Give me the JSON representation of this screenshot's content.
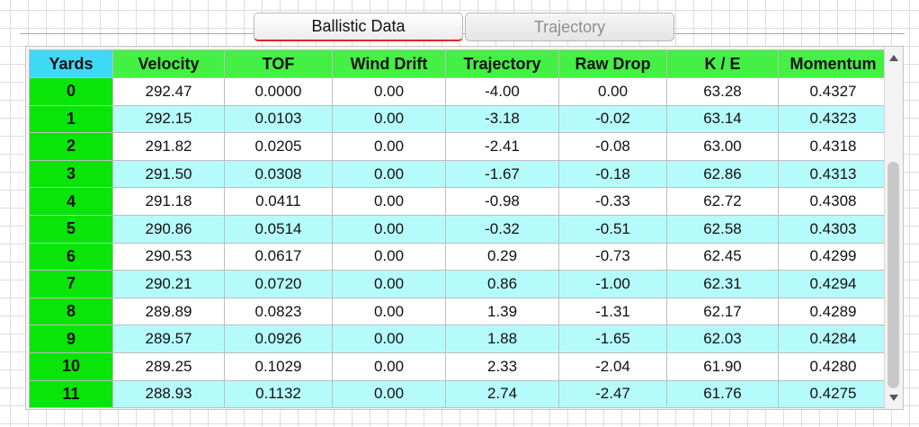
{
  "tabs": [
    {
      "label": "Ballistic Data",
      "active": true
    },
    {
      "label": "Trajectory",
      "active": false
    }
  ],
  "table": {
    "headers": [
      "Yards",
      "Velocity",
      "TOF",
      "Wind Drift",
      "Trajectory",
      "Raw Drop",
      "K / E",
      "Momentum"
    ],
    "rows": [
      [
        "0",
        "292.47",
        "0.0000",
        "0.00",
        "-4.00",
        "0.00",
        "63.28",
        "0.4327"
      ],
      [
        "1",
        "292.15",
        "0.0103",
        "0.00",
        "-3.18",
        "-0.02",
        "63.14",
        "0.4323"
      ],
      [
        "2",
        "291.82",
        "0.0205",
        "0.00",
        "-2.41",
        "-0.08",
        "63.00",
        "0.4318"
      ],
      [
        "3",
        "291.50",
        "0.0308",
        "0.00",
        "-1.67",
        "-0.18",
        "62.86",
        "0.4313"
      ],
      [
        "4",
        "291.18",
        "0.0411",
        "0.00",
        "-0.98",
        "-0.33",
        "62.72",
        "0.4308"
      ],
      [
        "5",
        "290.86",
        "0.0514",
        "0.00",
        "-0.32",
        "-0.51",
        "62.58",
        "0.4303"
      ],
      [
        "6",
        "290.53",
        "0.0617",
        "0.00",
        "0.29",
        "-0.73",
        "62.45",
        "0.4299"
      ],
      [
        "7",
        "290.21",
        "0.0720",
        "0.00",
        "0.86",
        "-1.00",
        "62.31",
        "0.4294"
      ],
      [
        "8",
        "289.89",
        "0.0823",
        "0.00",
        "1.39",
        "-1.31",
        "62.17",
        "0.4289"
      ],
      [
        "9",
        "289.57",
        "0.0926",
        "0.00",
        "1.88",
        "-1.65",
        "62.03",
        "0.4284"
      ],
      [
        "10",
        "289.25",
        "0.1029",
        "0.00",
        "2.33",
        "-2.04",
        "61.90",
        "0.4280"
      ],
      [
        "11",
        "288.93",
        "0.1132",
        "0.00",
        "2.74",
        "-2.47",
        "61.76",
        "0.4275"
      ]
    ]
  },
  "colors": {
    "header_green": "#43f043",
    "yards_header_cyan": "#3fd9f5",
    "yards_column_green": "#09e509",
    "alt_row_cyan": "#b6fbfb",
    "active_tab_underline": "#e0272b"
  }
}
